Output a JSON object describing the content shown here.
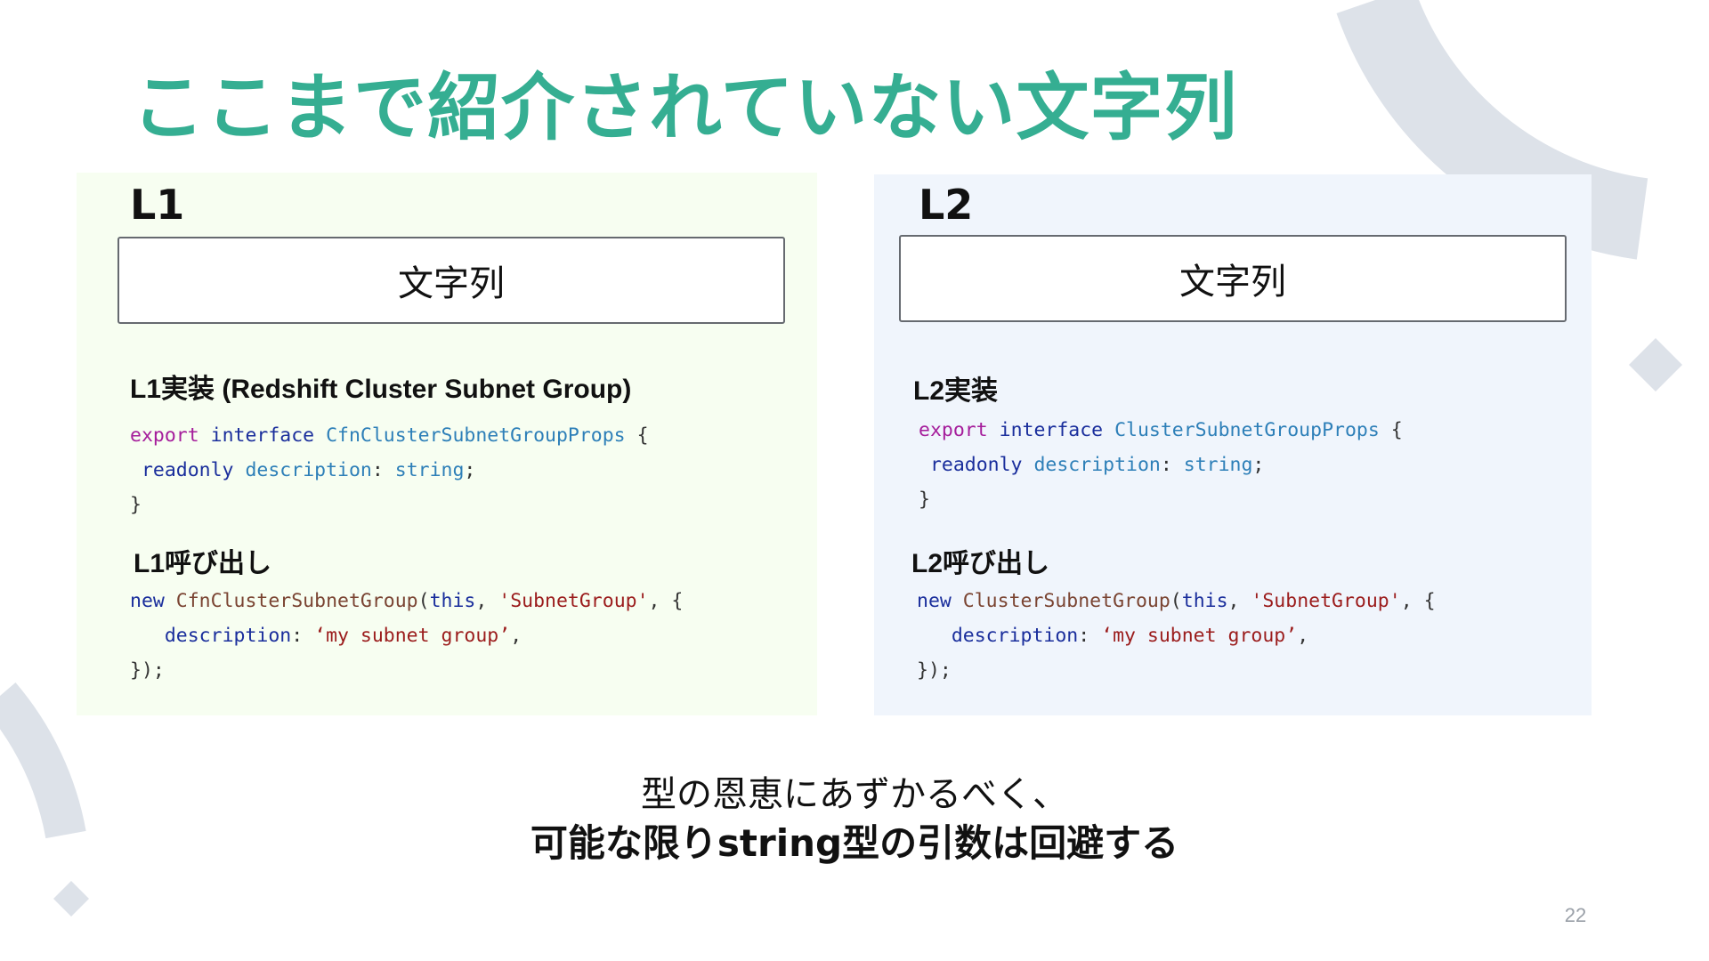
{
  "slide": {
    "title": "ここまで紹介されていない文字列",
    "page_number": "22"
  },
  "colors": {
    "title": "#35ae92",
    "decoration": "#dde2e9",
    "l1_panel": "#f7fef1",
    "l2_panel": "#f0f5fc"
  },
  "decorations": [
    "arc-decoration-top-right",
    "diamond-decoration-right",
    "arc-decoration-bottom-left",
    "diamond-decoration-bottom-left"
  ],
  "l1": {
    "label": "L1",
    "string_box": "文字列",
    "impl_heading": "L1実装 (Redshift Cluster Subnet Group)",
    "impl_code": {
      "kw_export": "export",
      "kw_interface": "interface",
      "type_name": "CfnClusterSubnetGroupProps",
      "open_brace": " {",
      "prop_readonly": "readonly",
      "prop_name": "description",
      "colon": ": ",
      "prop_type": "string",
      "semicolon": ";",
      "close_brace": "}"
    },
    "call_heading": "L1呼び出し",
    "call_code": {
      "kw_new": "new",
      "class_name": "CfnClusterSubnetGroup",
      "paren_open": "(",
      "kw_this": "this",
      "comma1": ", ",
      "id_string": "'SubnetGroup'",
      "comma2": ", {",
      "prop_key": "description",
      "colon": ": ",
      "prop_value": "‘my subnet group’",
      "comma3": ",",
      "close": "});"
    }
  },
  "l2": {
    "label": "L2",
    "string_box": "文字列",
    "impl_heading": "L2実装",
    "impl_code": {
      "kw_export": "export",
      "kw_interface": "interface",
      "type_name": "ClusterSubnetGroupProps",
      "open_brace": " {",
      "prop_readonly": "readonly",
      "prop_name": "description",
      "colon": ": ",
      "prop_type": "string",
      "semicolon": ";",
      "close_brace": "}"
    },
    "call_heading": "L2呼び出し",
    "call_code": {
      "kw_new": "new",
      "class_name": "ClusterSubnetGroup",
      "paren_open": "(",
      "kw_this": "this",
      "comma1": ", ",
      "id_string": "'SubnetGroup'",
      "comma2": ", {",
      "prop_key": "description",
      "colon": ": ",
      "prop_value": "‘my subnet group’",
      "comma3": ",",
      "close": "});"
    }
  },
  "summary": {
    "line1": "型の恩恵にあずかるべく、",
    "line2": "可能な限りstring型の引数は回避する"
  }
}
